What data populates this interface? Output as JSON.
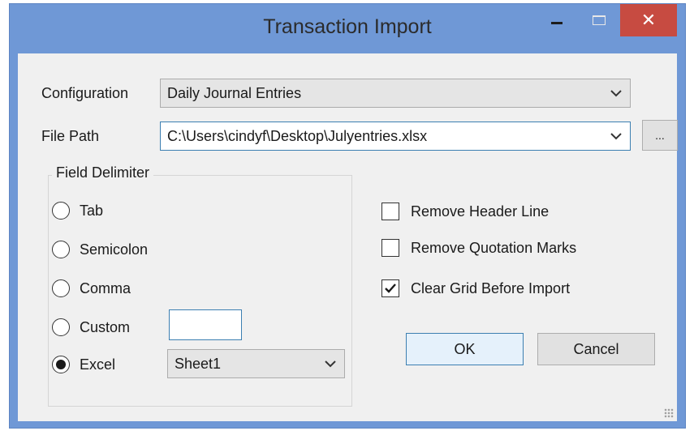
{
  "window": {
    "title": "Transaction Import",
    "close_glyph": "✕"
  },
  "form": {
    "configuration": {
      "label": "Configuration",
      "value": "Daily Journal Entries"
    },
    "file_path": {
      "label": "File Path",
      "value": "C:\\Users\\cindyf\\Desktop\\Julyentries.xlsx",
      "browse_label": "..."
    }
  },
  "field_delimiter": {
    "title": "Field Delimiter",
    "options": [
      {
        "label": "Tab",
        "selected": false
      },
      {
        "label": "Semicolon",
        "selected": false
      },
      {
        "label": "Comma",
        "selected": false
      },
      {
        "label": "Custom",
        "selected": false
      },
      {
        "label": "Excel",
        "selected": true
      }
    ],
    "custom_value": "",
    "excel_sheet": "Sheet1"
  },
  "options": {
    "remove_header": {
      "label": "Remove Header Line",
      "checked": false
    },
    "remove_quotes": {
      "label": "Remove Quotation Marks",
      "checked": false
    },
    "clear_grid": {
      "label": "Clear Grid Before Import",
      "checked": true
    }
  },
  "buttons": {
    "ok": "OK",
    "cancel": "Cancel"
  },
  "icons": {
    "dropdown": "chevron-down-icon",
    "minimize": "minimize-icon",
    "maximize": "maximize-icon",
    "close": "close-icon",
    "checkmark": "check-icon",
    "grip": "resize-grip-icon"
  },
  "colors": {
    "titlebar": "#6f98d6",
    "close_button": "#c74b41",
    "client_background": "#f0f0f0",
    "focus_border": "#3c7fb1"
  }
}
